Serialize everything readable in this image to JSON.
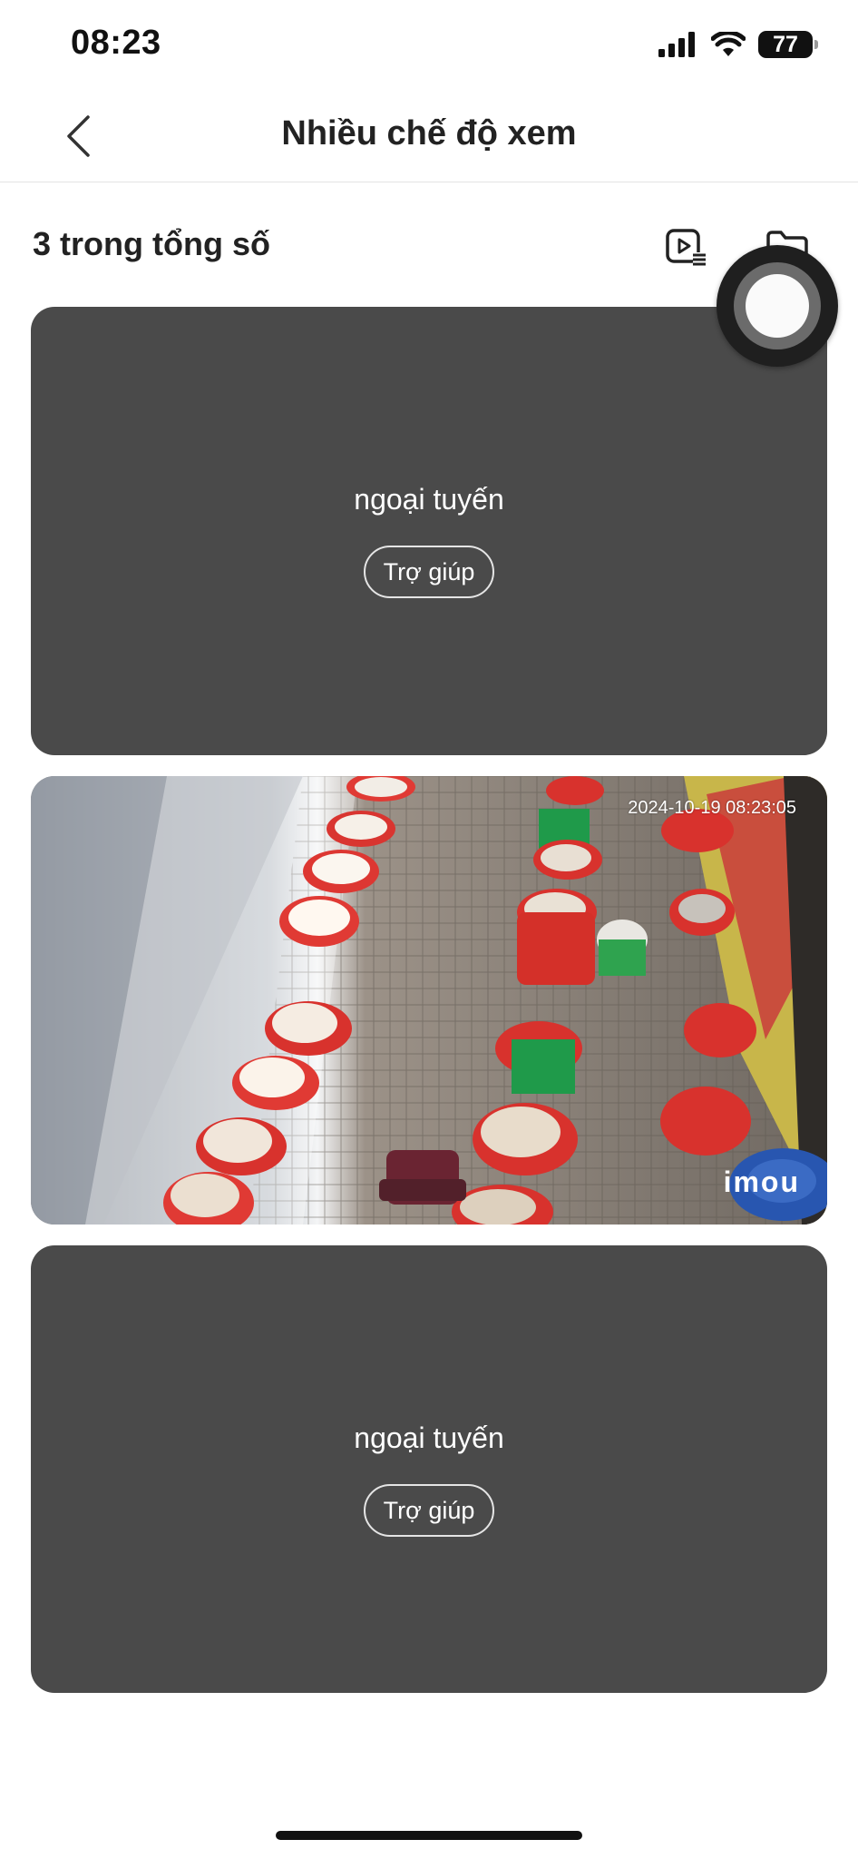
{
  "status_bar": {
    "time": "08:23",
    "battery": "77"
  },
  "nav": {
    "title": "Nhiều chế độ xem",
    "back_icon": "chevron-left-icon"
  },
  "toolbar": {
    "count_text": "3 trong tổng số",
    "playback_icon": "video-playlist-icon",
    "folder_icon": "folder-icon"
  },
  "cameras": [
    {
      "status": "ngoại tuyến",
      "help_label": "Trợ giúp"
    },
    {
      "timestamp": "2024-10-19 08:23:05",
      "brand": "imou"
    },
    {
      "status": "ngoại tuyến",
      "help_label": "Trợ giúp"
    }
  ],
  "colors": {
    "card_background": "#4a4a4a",
    "text_dark": "#222222"
  }
}
